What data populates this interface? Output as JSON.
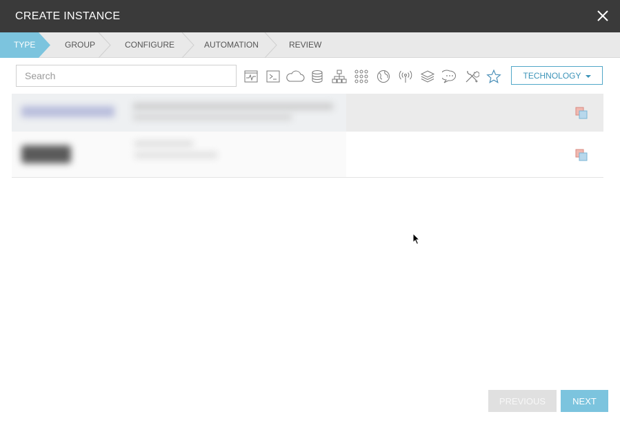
{
  "modal": {
    "title": "CREATE INSTANCE",
    "close_icon": "close-icon"
  },
  "wizard": {
    "steps": [
      {
        "label": "TYPE",
        "active": true
      },
      {
        "label": "GROUP",
        "active": false
      },
      {
        "label": "CONFIGURE",
        "active": false
      },
      {
        "label": "AUTOMATION",
        "active": false
      },
      {
        "label": "REVIEW",
        "active": false
      }
    ],
    "active_color": "#7cc4de"
  },
  "toolbar": {
    "search": {
      "placeholder": "Search",
      "value": ""
    },
    "filter_icons": [
      "app-monitor-icon",
      "terminal-icon",
      "cloud-icon",
      "database-icon",
      "network-tree-icon",
      "grid-icon",
      "globe-icon",
      "broadcast-icon",
      "layers-icon",
      "chat-icon",
      "tools-icon",
      "star-icon"
    ],
    "technology_label": "TECHNOLOGY"
  },
  "list": {
    "rows": [
      {
        "icon": "copy-icon"
      },
      {
        "icon": "copy-icon"
      }
    ]
  },
  "footer": {
    "previous_label": "PREVIOUS",
    "next_label": "NEXT"
  },
  "colors": {
    "header": "#3a3a3a",
    "accent": "#7cc4de",
    "technology_border": "#4fa6c7"
  }
}
